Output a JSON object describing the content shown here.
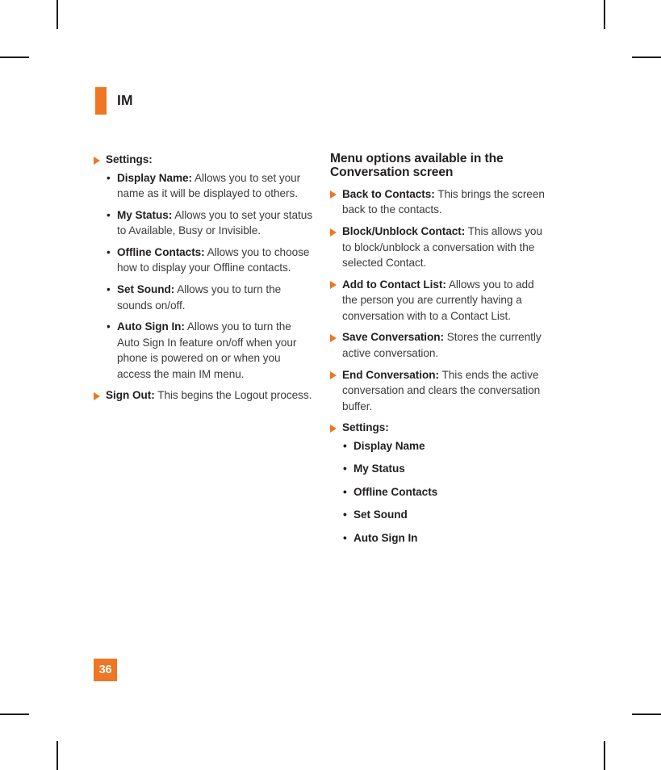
{
  "document": {
    "chapter_title": "IM",
    "page_number": "36",
    "accent_color": "#ef7622",
    "text_color": "#3b3b3b",
    "heading_color": "#231f20"
  },
  "left_column": {
    "settings_entry": {
      "label": "Settings:",
      "marker": "triangle-right-icon"
    },
    "settings_items": [
      {
        "lead": "Display Name:",
        "body": " Allows you to set your name as it will be displayed to others."
      },
      {
        "lead": "My Status:",
        "body": " Allows you to set your status to Available, Busy or Invisible."
      },
      {
        "lead": "Offline Contacts:",
        "body": " Allows you to choose how to display your Offline contacts."
      },
      {
        "lead": "Set Sound:",
        "body": " Allows you to turn the sounds on/off."
      },
      {
        "lead": "Auto Sign In:",
        "body": " Allows you to turn the Auto Sign In feature on/off when your phone is powered on or when you access the main IM menu."
      }
    ],
    "sign_out": {
      "lead": "Sign Out:",
      "body": " This begins the Logout process."
    }
  },
  "right_column": {
    "heading": "Menu options available in the Conversation screen",
    "entries": [
      {
        "lead": "Back to Contacts:",
        "body": " This brings the screen back to the contacts."
      },
      {
        "lead": "Block/Unblock Contact:",
        "body": " This allows you to block/unblock a conversation with the selected Contact."
      },
      {
        "lead": "Add to Contact List:",
        "body": " Allows you to add the person you are currently having a conversation with to a Contact List."
      },
      {
        "lead": "Save Conversation:",
        "body": " Stores the currently active conversation."
      },
      {
        "lead": "End Conversation:",
        "body": " This ends the active conversation and clears the conversation buffer."
      }
    ],
    "settings_entry": {
      "label": "Settings:",
      "marker": "triangle-right-icon"
    },
    "settings_items": [
      {
        "label": "Display Name"
      },
      {
        "label": "My Status"
      },
      {
        "label": "Offline Contacts"
      },
      {
        "label": "Set Sound"
      },
      {
        "label": "Auto Sign In"
      }
    ]
  }
}
